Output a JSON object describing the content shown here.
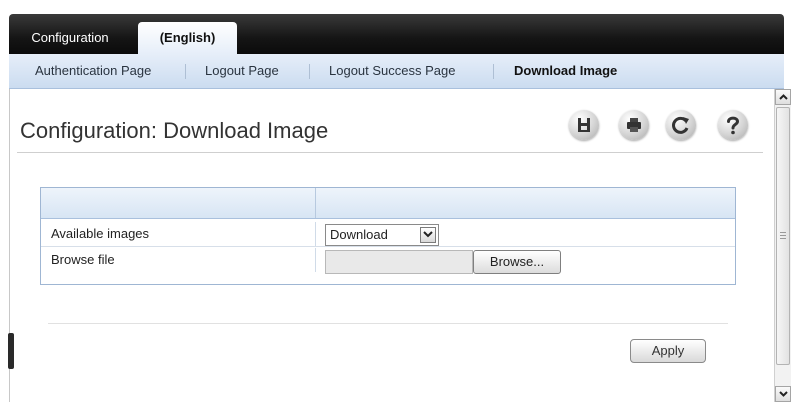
{
  "tabs": [
    {
      "label": "Configuration"
    },
    {
      "label": "(English)"
    }
  ],
  "subnav": {
    "items": [
      {
        "label": "Authentication Page"
      },
      {
        "label": "Logout Page"
      },
      {
        "label": "Logout Success Page"
      },
      {
        "label": "Download Image"
      }
    ],
    "active": "Download Image"
  },
  "page": {
    "title": "Configuration: Download Image"
  },
  "toolbar": {
    "icons": [
      "save-icon",
      "print-icon",
      "refresh-icon",
      "help-icon"
    ]
  },
  "form": {
    "rows": [
      {
        "label": "Available images",
        "control": "select",
        "value": "Download"
      },
      {
        "label": "Browse file",
        "control": "file",
        "value": "",
        "button_label": "Browse..."
      }
    ]
  },
  "actions": {
    "apply_label": "Apply"
  },
  "colors": {
    "tabbar": "#151515",
    "subnav": "#d7e5f4",
    "panel_border": "#9fb6d3"
  }
}
